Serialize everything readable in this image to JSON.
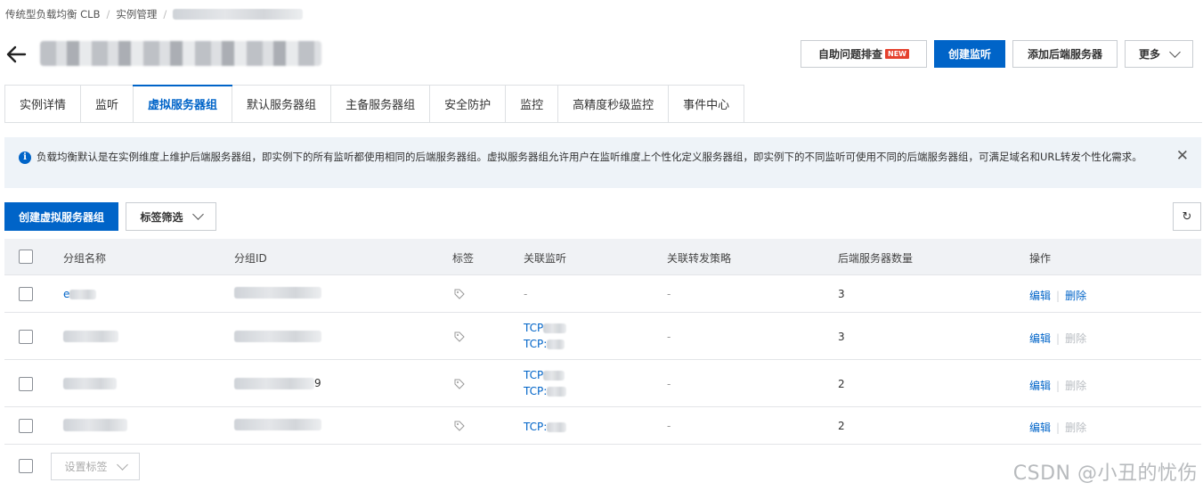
{
  "breadcrumb": [
    "传统型负载均衡 CLB",
    "实例管理"
  ],
  "header_buttons": {
    "self_diagnose": "自助问题排查",
    "new_badge": "NEW",
    "create_listener": "创建监听",
    "add_backend": "添加后端服务器",
    "more": "更多"
  },
  "tabs": [
    "实例详情",
    "监听",
    "虚拟服务器组",
    "默认服务器组",
    "主备服务器组",
    "安全防护",
    "监控",
    "高精度秒级监控",
    "事件中心"
  ],
  "active_tab": "虚拟服务器组",
  "alert": {
    "text": "负载均衡默认是在实例维度上维护后端服务器组，即实例下的所有监听都使用相同的后端服务器组。虚拟服务器组允许用户在监听维度上个性化定义服务器组，即实例下的不同监听可使用不同的后端服务器组，可满足域名和URL转发个性化需求。"
  },
  "toolbar": {
    "create": "创建虚拟服务器组",
    "tag_filter": "标签筛选"
  },
  "table": {
    "headers": [
      "分组名称",
      "分组ID",
      "标签",
      "关联监听",
      "关联转发策略",
      "后端服务器数量",
      "操作"
    ],
    "rows": [
      {
        "name": "e",
        "id": "",
        "listeners": [
          "-"
        ],
        "policy": "-",
        "count": "3",
        "edit": "编辑",
        "delete": "删除",
        "delete_enabled": true
      },
      {
        "name": "",
        "id": "",
        "listeners": [
          "TCP",
          "TCP:"
        ],
        "policy": "-",
        "count": "3",
        "edit": "编辑",
        "delete": "删除",
        "delete_enabled": false
      },
      {
        "name": "",
        "id": "9",
        "listeners": [
          "TCP",
          "TCP:"
        ],
        "policy": "-",
        "count": "2",
        "edit": "编辑",
        "delete": "删除",
        "delete_enabled": false
      },
      {
        "name": "",
        "id": "",
        "listeners": [
          "TCP:"
        ],
        "policy": "-",
        "count": "2",
        "edit": "编辑",
        "delete": "删除",
        "delete_enabled": false
      }
    ]
  },
  "footer": {
    "set_tag": "设置标签"
  },
  "watermark": "CSDN @小丑的忧伤",
  "colors": {
    "primary": "#0064c8",
    "alert_bg": "#eef3f8",
    "header_bg": "#f0f2f5",
    "badge": "#e5412e"
  }
}
